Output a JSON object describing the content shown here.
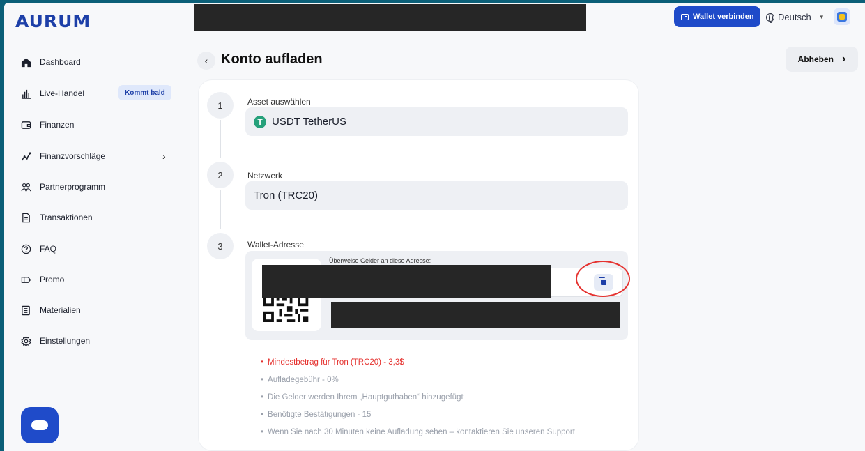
{
  "header": {
    "logo": "AURUM",
    "wallet_button": "Wallet verbinden",
    "language": "Deutsch"
  },
  "sidebar": {
    "items": [
      {
        "label": "Dashboard",
        "icon": "home-icon"
      },
      {
        "label": "Live-Handel",
        "icon": "chart-bars-icon",
        "badge": "Kommt bald"
      },
      {
        "label": "Finanzen",
        "icon": "wallet-icon"
      },
      {
        "label": "Finanzvorschläge",
        "icon": "trend-icon",
        "has_submenu": true
      },
      {
        "label": "Partnerprogramm",
        "icon": "people-icon"
      },
      {
        "label": "Transaktionen",
        "icon": "document-icon"
      },
      {
        "label": "FAQ",
        "icon": "question-icon"
      },
      {
        "label": "Promo",
        "icon": "promo-icon"
      },
      {
        "label": "Materialien",
        "icon": "materials-icon"
      },
      {
        "label": "Einstellungen",
        "icon": "gear-icon"
      }
    ]
  },
  "main": {
    "title": "Konto aufladen",
    "withdraw_button": "Abheben",
    "steps": [
      {
        "number": "1",
        "label": "Asset auswählen",
        "value": "USDT TetherUS"
      },
      {
        "number": "2",
        "label": "Netzwerk",
        "value": "Tron (TRC20)"
      },
      {
        "number": "3",
        "label": "Wallet-Adresse"
      }
    ],
    "address_label": "Überweise Gelder an diese Adresse:",
    "info": [
      "Mindestbetrag für Tron (TRC20) - 3,3$",
      "Aufladegebühr - 0%",
      "Die Gelder werden Ihrem „Hauptguthaben“ hinzugefügt",
      "Benötigte Bestätigungen - 15",
      "Wenn Sie nach 30 Minuten keine Aufladung sehen – kontaktieren Sie unseren Support"
    ]
  },
  "colors": {
    "brand": "#1d3fa8",
    "primary_button": "#1f4bc9",
    "warning": "#e5322f",
    "tether": "#26a17b"
  }
}
